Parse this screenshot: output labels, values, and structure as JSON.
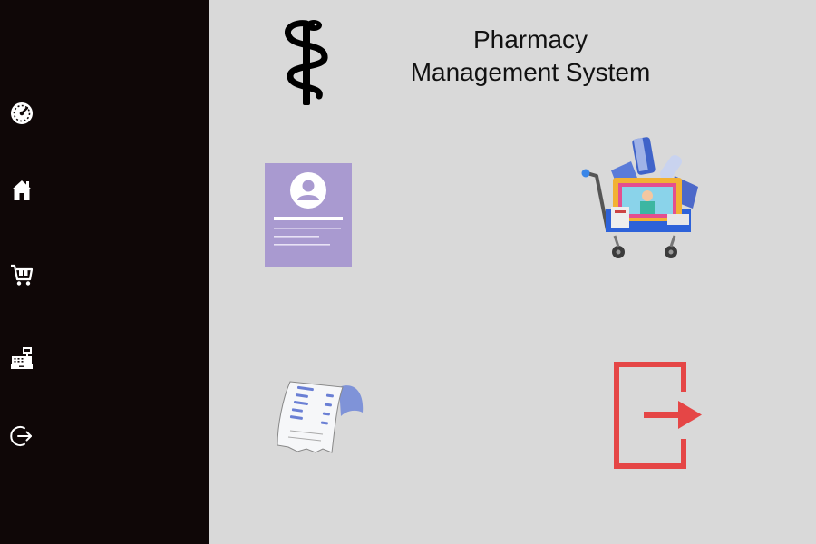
{
  "header": {
    "title_line1": "Pharmacy",
    "title_line2": "Management System"
  },
  "sidebar": {
    "items": [
      {
        "icon": "dashboard-gauge-icon"
      },
      {
        "icon": "home-icon"
      },
      {
        "icon": "cart-icon"
      },
      {
        "icon": "cash-register-icon"
      },
      {
        "icon": "logout-icon"
      }
    ]
  },
  "tiles": [
    {
      "icon": "profile-card-icon"
    },
    {
      "icon": "pharmacy-cart-icon"
    },
    {
      "icon": "receipt-icon"
    },
    {
      "icon": "exit-icon"
    }
  ],
  "colors": {
    "sidebar_bg": "#0f0707",
    "main_bg": "#d9d9d9",
    "profile_card": "#a99ad0",
    "exit_red": "#e54646",
    "receipt_accent": "#7f93d8"
  }
}
